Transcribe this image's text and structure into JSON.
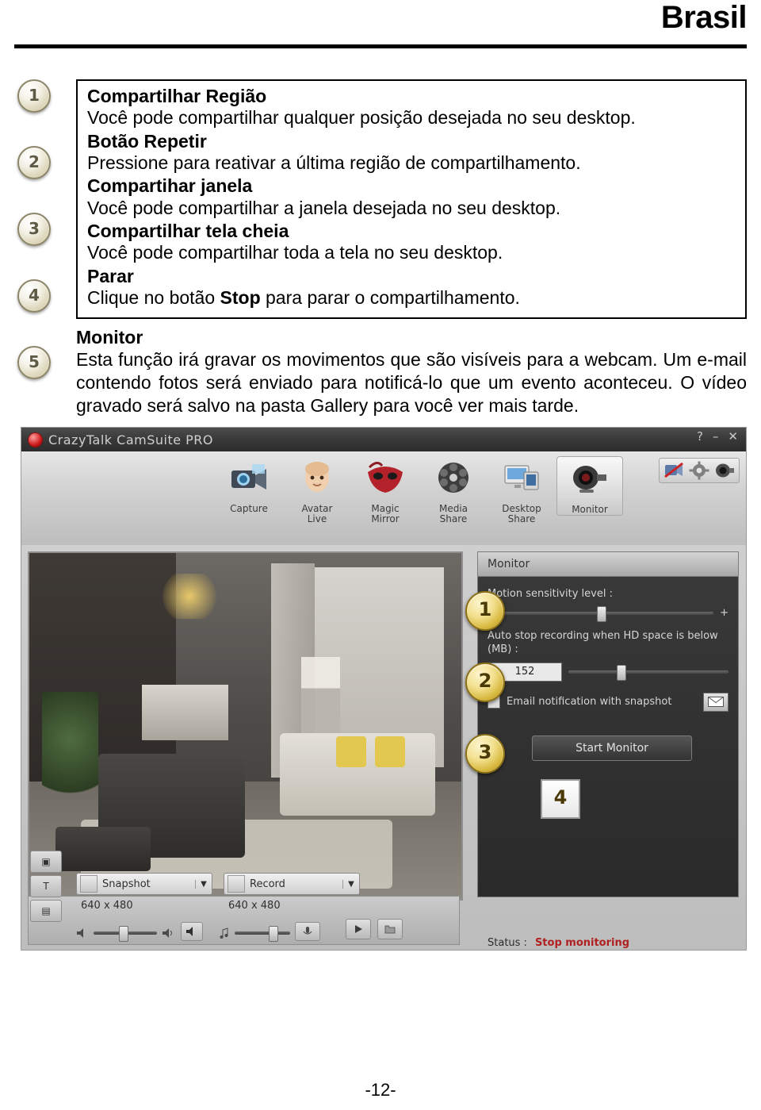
{
  "header": {
    "brand": "Brasil"
  },
  "callouts": [
    "1",
    "2",
    "3",
    "4",
    "5"
  ],
  "instructions": [
    {
      "title": "Compartilhar Região",
      "desc": "Você pode compartilhar qualquer posição desejada no seu desktop."
    },
    {
      "title": "Botão Repetir",
      "desc": "Pressione para reativar a última região de compartilhamento."
    },
    {
      "title": "Compartihar janela",
      "desc": "Você pode compartilhar a janela desejada no seu desktop."
    },
    {
      "title": "Compartilhar tela cheia",
      "desc": "Você pode compartilhar toda a tela no seu desktop."
    },
    {
      "title": "Parar",
      "desc_before": "Clique no botão ",
      "desc_bold": "Stop",
      "desc_after": " para parar o compartilhamento."
    }
  ],
  "monitor_section": {
    "title": "Monitor",
    "text": "Esta função irá gravar os movimentos que são visíveis para a webcam. Um e-mail contendo fotos será enviado para notificá-lo que um evento aconteceu. O vídeo gravado será salvo na pasta Gallery para você ver mais tarde."
  },
  "app": {
    "title": "CrazyTalk CamSuite PRO",
    "window_buttons": [
      "?",
      "–",
      "✕"
    ],
    "toolbar": [
      {
        "label_line1": "Capture",
        "label_line2": "",
        "icon": "camera-icon"
      },
      {
        "label_line1": "Avatar",
        "label_line2": "Live",
        "icon": "avatar-icon"
      },
      {
        "label_line1": "Magic",
        "label_line2": "Mirror",
        "icon": "mask-icon"
      },
      {
        "label_line1": "Media",
        "label_line2": "Share",
        "icon": "film-icon"
      },
      {
        "label_line1": "Desktop",
        "label_line2": "Share",
        "icon": "monitor-share-icon"
      },
      {
        "label_line1": "Monitor",
        "label_line2": "",
        "icon": "webcam-icon"
      }
    ],
    "top_right_icons": [
      "no-video-icon",
      "gear-icon",
      "camera-settings-icon"
    ],
    "panel": {
      "heading": "Monitor",
      "sensitivity_label": "Motion sensitivity level :",
      "sensitivity_minus": "-",
      "sensitivity_plus": "+",
      "autostop_label": "Auto stop recording when HD space is below (MB) :",
      "autostop_value": "152",
      "email_label": "Email notification with snapshot",
      "email_button_icon": "envelope-icon",
      "start_button": "Start Monitor"
    },
    "bottom_bar": {
      "snapshot_label": "Snapshot",
      "snapshot_res": "640 x 480",
      "record_label": "Record",
      "record_res": "640 x 480"
    },
    "status": {
      "label": "Status :",
      "value": "Stop monitoring"
    },
    "overlay_callouts": [
      "1",
      "2",
      "3",
      "4"
    ]
  },
  "footer": {
    "page_number": "-12-"
  }
}
